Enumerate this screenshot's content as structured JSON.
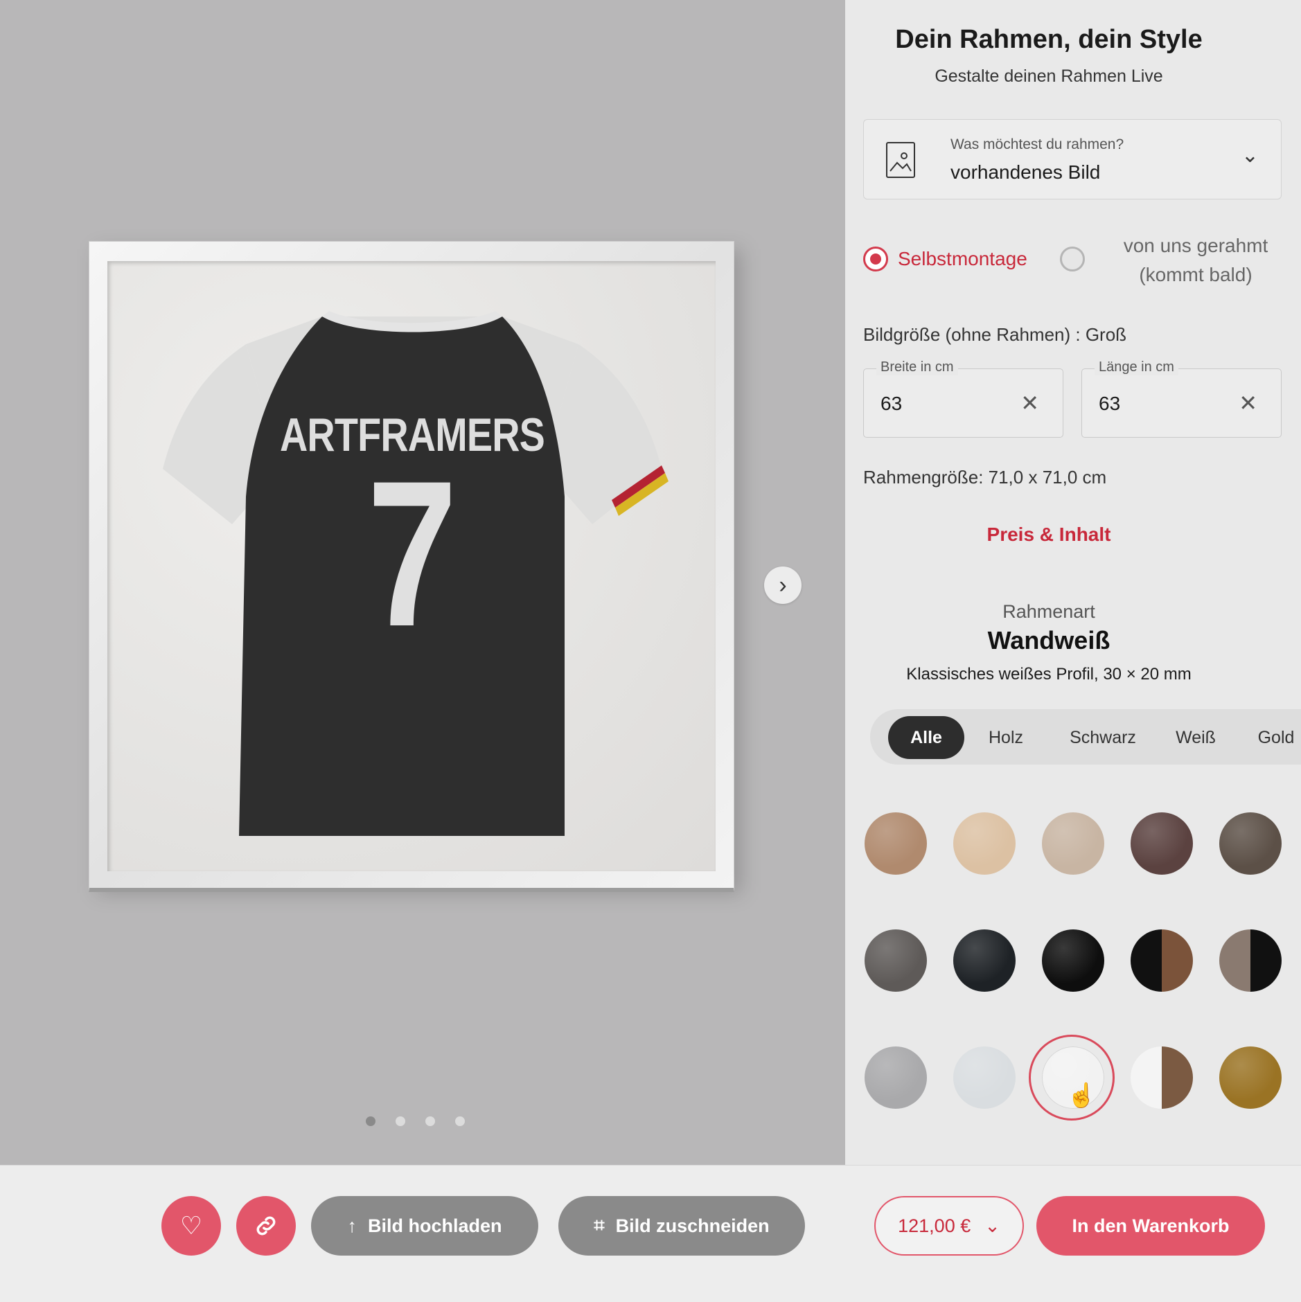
{
  "preview": {
    "jersey": {
      "name": "ARTFRAMERS",
      "number": "7"
    },
    "next_icon": "chevron-right-icon",
    "carousel": {
      "count": 4,
      "active": 0
    }
  },
  "config": {
    "title": "Dein Rahmen, dein Style",
    "subtitle": "Gestalte deinen Rahmen Live",
    "type_select": {
      "label": "Was möchtest du rahmen?",
      "value": "vorhandenes Bild",
      "icon": "image-icon"
    },
    "mounting": {
      "option_self": "Selbstmontage",
      "option_us": "von uns gerahmt (kommt bald)",
      "selected": "Selbstmontage"
    },
    "size_heading": "Bildgröße (ohne Rahmen) : Groß",
    "width": {
      "label": "Breite in cm",
      "value": "63"
    },
    "length": {
      "label": "Länge in cm",
      "value": "63"
    },
    "frame_size": "Rahmengröße: 71,0 x 71,0 cm",
    "price_link": "Preis & Inhalt",
    "rahmenart": {
      "label": "Rahmenart",
      "name": "Wandweiß",
      "description": "Klassisches weißes Profil, 30 × 20 mm"
    },
    "filters": [
      "Alle",
      "Holz",
      "Schwarz",
      "Weiß",
      "Gold"
    ],
    "active_filter": "Alle",
    "swatches": [
      [
        "#b08a6e",
        "#dcc1a3",
        "#c8b5a3",
        "#5b4240",
        "#5c5047"
      ],
      [
        "#5e5a58",
        "#1e2226",
        "#0e0e0e",
        "split:#111111|#7b533a",
        "split:#8a7a70|#111111"
      ],
      [
        "#a9a9ab",
        "#d9dde0",
        "#f2f2f2",
        "split:#f4f4f4|#7b5a42",
        "#9a7324"
      ]
    ],
    "selected_swatch": "Wandweiß"
  },
  "bottom": {
    "favorite_icon": "heart-icon",
    "share_icon": "link-icon",
    "upload_label": "Bild hochladen",
    "crop_label": "Bild zuschneiden",
    "price": "121,00 €",
    "cart_label": "In den Warenkorb"
  },
  "colors": {
    "accent": "#e2566a",
    "accent_text": "#c8283a",
    "dark": "#2d2d2d"
  }
}
